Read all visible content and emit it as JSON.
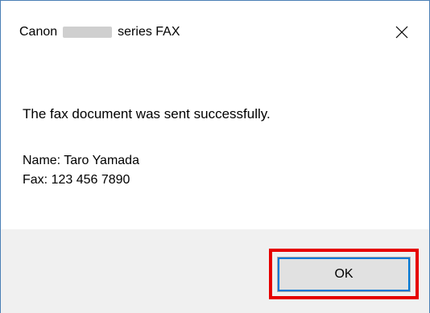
{
  "window": {
    "title_prefix": "Canon",
    "title_suffix": "series FAX",
    "close_icon": "close-icon"
  },
  "message": {
    "text": "The fax document was sent successfully."
  },
  "details": {
    "name_line": "Name: Taro Yamada",
    "fax_line": "Fax: 123 456 7890"
  },
  "buttons": {
    "ok_label": "OK"
  },
  "colors": {
    "highlight": "#e60000",
    "footer": "#f0f0f0",
    "focus": "#0078d7"
  }
}
